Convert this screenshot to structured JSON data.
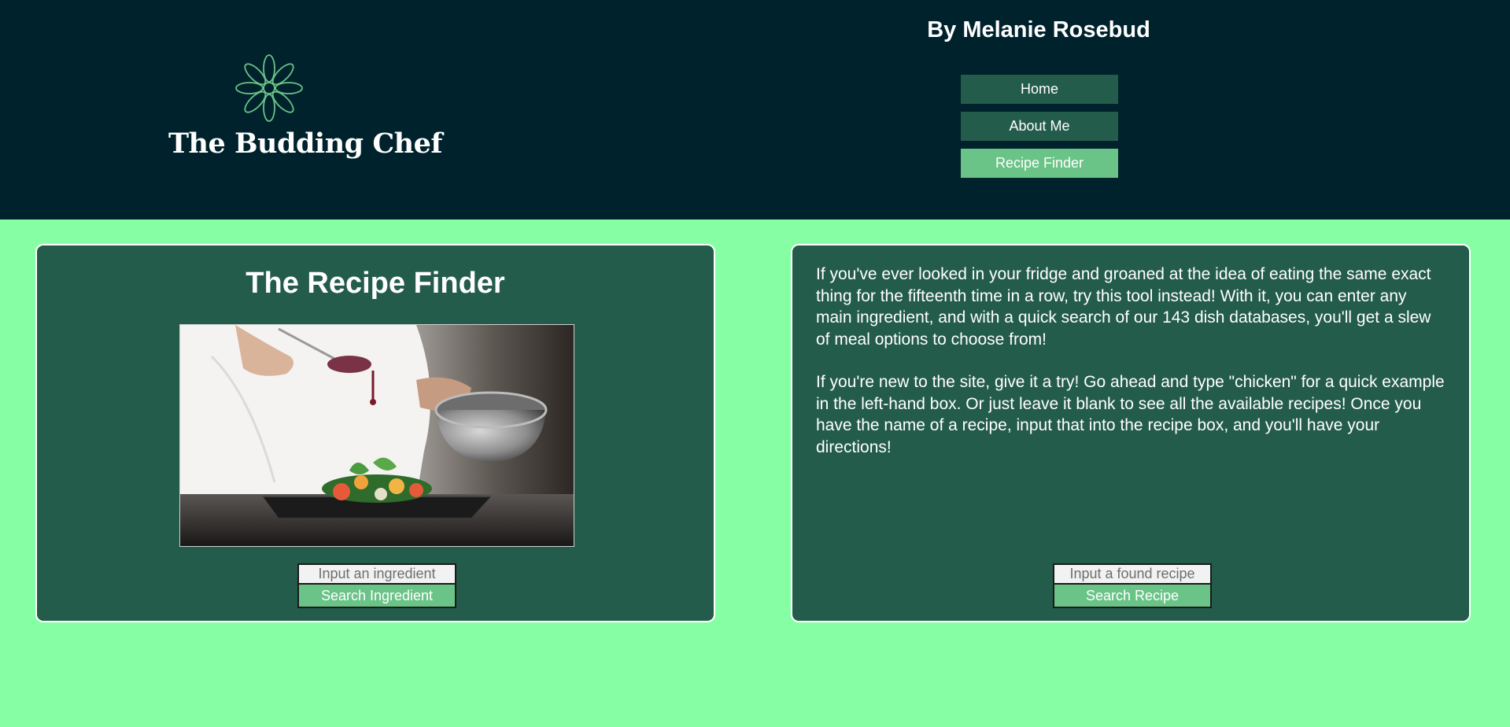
{
  "header": {
    "logo_text": "The Budding Chef",
    "author": "By Melanie Rosebud",
    "nav": [
      {
        "label": "Home",
        "active": false
      },
      {
        "label": "About Me",
        "active": false
      },
      {
        "label": "Recipe Finder",
        "active": true
      }
    ]
  },
  "left_panel": {
    "title": "The Recipe Finder",
    "image_icon": "chef-plating-photo",
    "ingredient_placeholder": "Input an ingredient",
    "search_label": "Search Ingredient"
  },
  "right_panel": {
    "paragraphs": [
      "If you've ever looked in your fridge and groaned at the idea of eating the same exact thing for the fifteenth time in a row, try this tool instead! With it, you can enter any main ingredient, and with a quick search of our 143 dish databases, you'll get a slew of meal options to choose from!",
      "If you're new to the site, give it a try! Go ahead and type \"chicken\" for a quick example in the left-hand box. Or just leave it blank to see all the available recipes! Once you have the name of a recipe, input that into the recipe box, and you'll have your directions!"
    ],
    "recipe_placeholder": "Input a found recipe",
    "search_label": "Search Recipe"
  },
  "colors": {
    "header_bg": "#00222c",
    "page_bg": "#86ffa4",
    "panel_bg": "#245c4c",
    "accent": "#6ac387"
  }
}
